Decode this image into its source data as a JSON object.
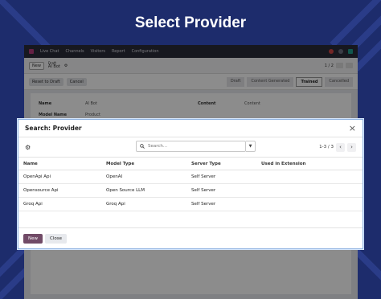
{
  "headline": "Select Provider",
  "background_app": {
    "app_name": "Live Chat",
    "menu": [
      "Channels",
      "Visitors",
      "Report",
      "Configuration"
    ],
    "new_button": "New",
    "breadcrumb_top": "Draft",
    "breadcrumb_record": "AI Bot",
    "pager": "1 / 2",
    "status_buttons": [
      "Reset to Draft",
      "Cancel"
    ],
    "stages": [
      "Draft",
      "Content Generated",
      "Trained",
      "Cancelled"
    ],
    "active_stage": "Trained",
    "fields": [
      {
        "label": "Name",
        "value": "AI Bot",
        "label2": "Content",
        "value2": "Content"
      },
      {
        "label": "Model Name",
        "value": "Product",
        "label2": "",
        "value2": ""
      }
    ]
  },
  "dialog": {
    "title": "Search: Provider",
    "search_placeholder": "Search...",
    "pager": "1-3 / 3",
    "columns": [
      "Name",
      "Model Type",
      "Server Type",
      "Used in Extension"
    ],
    "rows": [
      {
        "name": "OpenApi Api",
        "model_type": "OpenAI",
        "server_type": "Self Server",
        "used": ""
      },
      {
        "name": "Opensource Api",
        "model_type": "Open Source LLM",
        "server_type": "Self Server",
        "used": ""
      },
      {
        "name": "Groq Api",
        "model_type": "Groq Api",
        "server_type": "Self Server",
        "used": ""
      }
    ],
    "new_label": "New",
    "close_label": "Close"
  },
  "colors": {
    "page_bg": "#1d2c6c",
    "brand": "#714b67",
    "dialog_border": "#8cb0e0"
  }
}
